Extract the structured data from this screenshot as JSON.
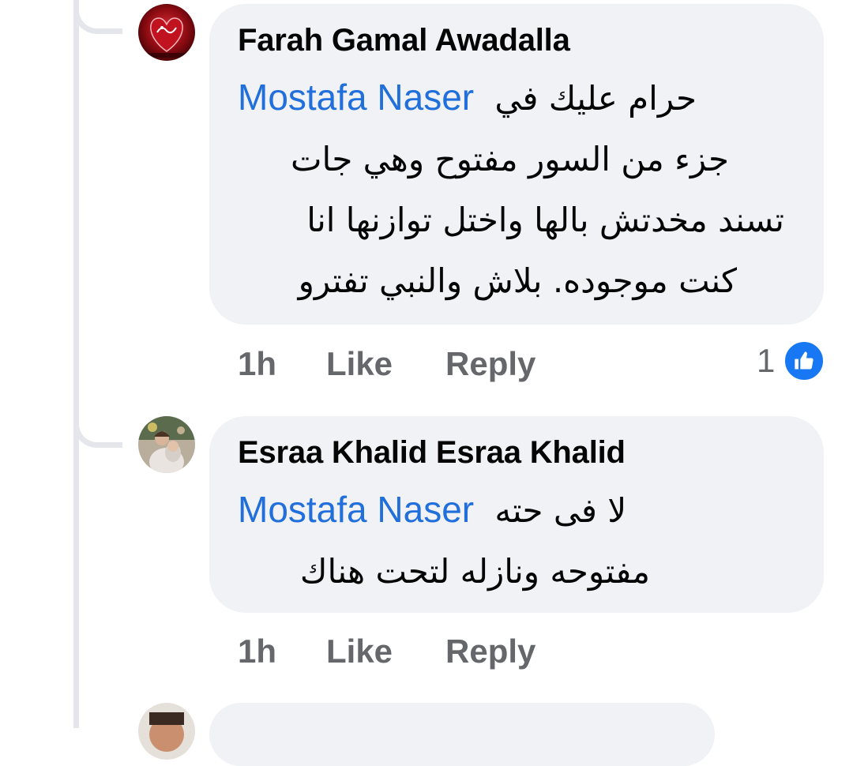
{
  "comments": [
    {
      "author": "Farah Gamal Awadalla",
      "mention": "Mostafa Naser",
      "lines": [
        "حرام عليك في",
        "جزء من السور مفتوح وهي جات",
        "تسند مخدتش بالها واختل توازنها انا",
        "كنت موجوده. بلاش والنبي تفترو"
      ],
      "time": "1h",
      "like_label": "Like",
      "reply_label": "Reply",
      "reaction_count": "1",
      "reaction_icon": "thumbs-up-icon",
      "avatar_icon": "red-heart-calligraphy-avatar"
    },
    {
      "author": "Esraa Khalid Esraa Khalid",
      "mention": "Mostafa Naser",
      "lines": [
        "لا فى حته",
        "مفتوحه  ونازله لتحت هناك"
      ],
      "time": "1h",
      "like_label": "Like",
      "reply_label": "Reply",
      "avatar_icon": "photo-avatar"
    }
  ],
  "colors": {
    "bubble": "#f0f2f5",
    "mention": "#216fdb",
    "meta": "#65676b",
    "like_badge": "#1877f2",
    "thread_line": "#e4e6eb"
  }
}
